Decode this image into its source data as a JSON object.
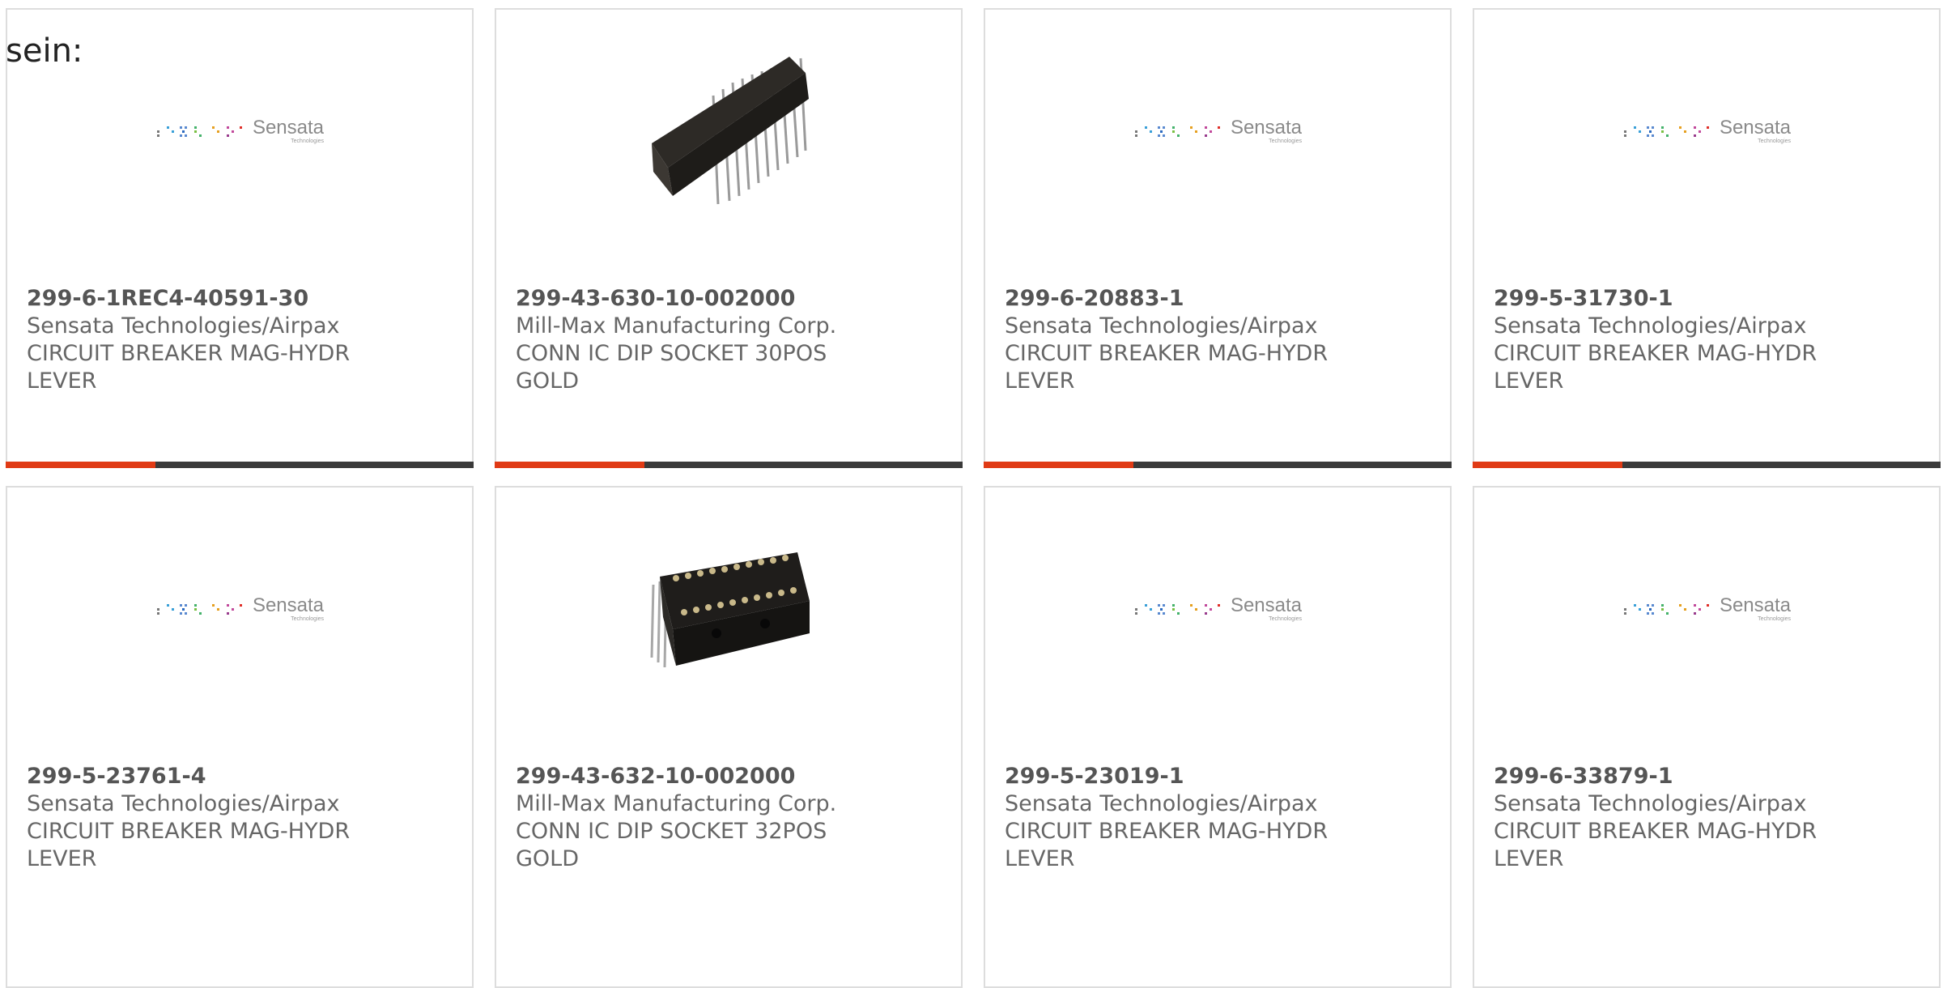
{
  "lead_text": "sein:",
  "products": [
    {
      "part_number": "299-6-1REC4-40591-30",
      "manufacturer": "Sensata Technologies/Airpax",
      "description": "CIRCUIT BREAKER MAG-HYDR LEVER",
      "image": "sensata-logo",
      "progress": 0.32
    },
    {
      "part_number": "299-43-630-10-002000",
      "manufacturer": "Mill-Max Manufacturing Corp.",
      "description": "CONN IC DIP SOCKET 30POS GOLD",
      "image": "dip-socket-side-photo",
      "progress": 0.32
    },
    {
      "part_number": "299-6-20883-1",
      "manufacturer": "Sensata Technologies/Airpax",
      "description": "CIRCUIT BREAKER MAG-HYDR LEVER",
      "image": "sensata-logo",
      "progress": 0.32
    },
    {
      "part_number": "299-5-31730-1",
      "manufacturer": "Sensata Technologies/Airpax",
      "description": "CIRCUIT BREAKER MAG-HYDR LEVER",
      "image": "sensata-logo",
      "progress": 0.32
    },
    {
      "part_number": "299-5-23761-4",
      "manufacturer": "Sensata Technologies/Airpax",
      "description": "CIRCUIT BREAKER MAG-HYDR LEVER",
      "image": "sensata-logo"
    },
    {
      "part_number": "299-43-632-10-002000",
      "manufacturer": "Mill-Max Manufacturing Corp.",
      "description": "CONN IC DIP SOCKET 32POS GOLD",
      "image": "dip-socket-top-photo"
    },
    {
      "part_number": "299-5-23019-1",
      "manufacturer": "Sensata Technologies/Airpax",
      "description": "CIRCUIT BREAKER MAG-HYDR LEVER",
      "image": "sensata-logo"
    },
    {
      "part_number": "299-6-33879-1",
      "manufacturer": "Sensata Technologies/Airpax",
      "description": "CIRCUIT BREAKER MAG-HYDR LEVER",
      "image": "sensata-logo"
    }
  ],
  "logo": {
    "name": "Sensata",
    "sub": "Technologies"
  },
  "colors": {
    "accent": "#e03a15",
    "bar_track": "#3a3a3a",
    "border": "#dddddd",
    "text": "#666666"
  }
}
